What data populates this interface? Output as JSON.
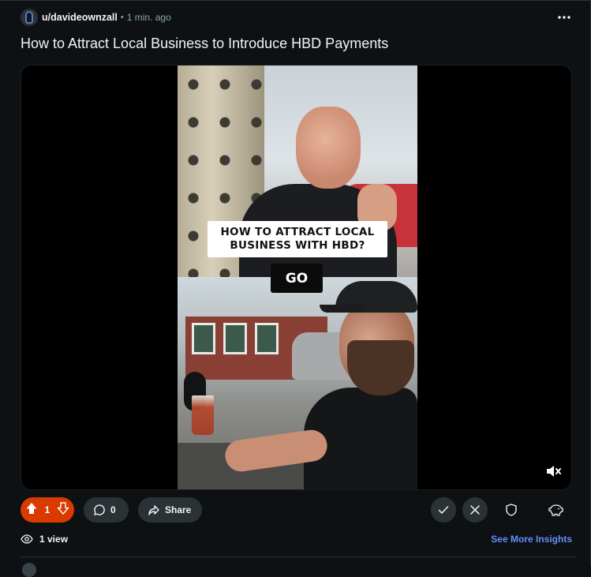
{
  "header": {
    "username": "u/davideownzall",
    "separator": "•",
    "time": "1 min. ago",
    "menu_icon": "more-horizontal-icon"
  },
  "post": {
    "title": "How to Attract Local Business to Introduce HBD Payments"
  },
  "video": {
    "overlay_line1": "HOW TO ATTRACT LOCAL",
    "overlay_line2": "BUSINESS WITH HBD?",
    "button_text": "GO",
    "mute_icon": "volume-muted-icon"
  },
  "actions": {
    "vote_count": "1",
    "comment_count": "0",
    "share_label": "Share",
    "upvote_icon": "upvote-arrow-icon",
    "downvote_icon": "downvote-arrow-icon",
    "comment_icon": "comment-bubble-icon",
    "share_icon": "share-arrow-icon",
    "approve_icon": "check-icon",
    "remove_icon": "close-icon",
    "mod_icon": "shield-icon",
    "insights_icon": "piggy-bank-icon",
    "vote_bg_color": "#d93a00"
  },
  "footer": {
    "views": "1 view",
    "views_icon": "eye-views-icon",
    "insights_link": "See More Insights",
    "link_color": "#648efc"
  }
}
